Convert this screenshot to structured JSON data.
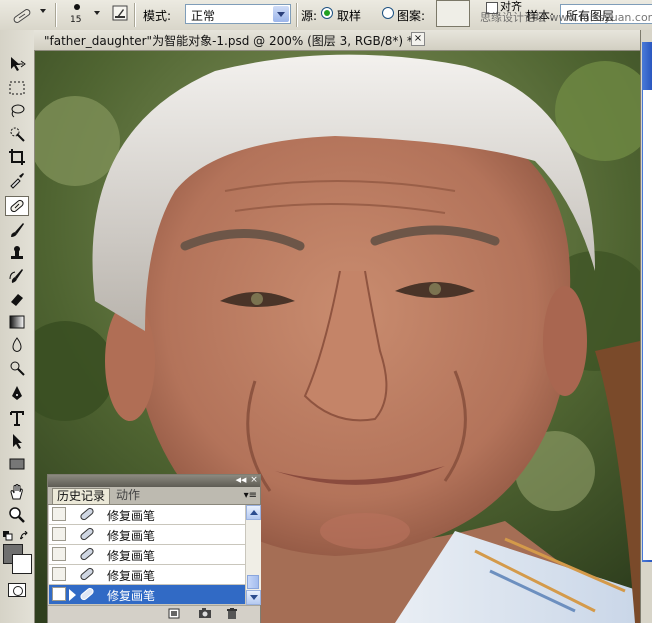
{
  "options_bar": {
    "brush_size": "15",
    "mode_label": "模式:",
    "mode_value": "正常",
    "source_label": "源:",
    "sample_option": "取样",
    "pattern_option": "图案:",
    "aligned_label": "对齐",
    "sample_layers_label": "样本:",
    "sample_layers_value": "所有图层",
    "watermark": "思缘设计论坛 www.missyuan.com"
  },
  "document": {
    "tab_title": "\"father_daughter\"为智能对象-1.psd @ 200% (图层 3, RGB/8*) *",
    "close_glyph": "×"
  },
  "history_panel": {
    "tabs": [
      {
        "label": "历史记录",
        "active": true
      },
      {
        "label": "动作",
        "active": false
      }
    ],
    "items": [
      {
        "label": "修复画笔",
        "selected": false
      },
      {
        "label": "修复画笔",
        "selected": false
      },
      {
        "label": "修复画笔",
        "selected": false
      },
      {
        "label": "修复画笔",
        "selected": false
      },
      {
        "label": "修复画笔",
        "selected": true
      }
    ],
    "collapse_glyph": "◀◀",
    "close_glyph": "×",
    "menu_glyph": "▾≡"
  },
  "colors": {
    "selection": "#316ac5",
    "panel_bg": "#d4d0c8",
    "accent_blue": "#2a57c0"
  }
}
